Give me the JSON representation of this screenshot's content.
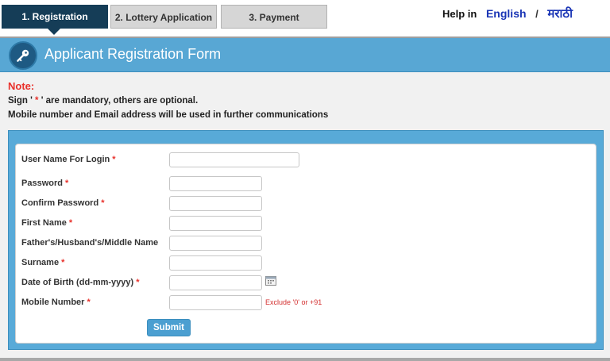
{
  "steps": [
    {
      "label": "1. Registration",
      "active": true
    },
    {
      "label": "2. Lottery Application",
      "active": false
    },
    {
      "label": "3. Payment",
      "active": false
    }
  ],
  "help": {
    "label": "Help in",
    "languages": [
      "English",
      "मराठी"
    ],
    "separator": "/"
  },
  "banner": {
    "title": "Applicant Registration Form",
    "icon": "key-icon"
  },
  "note": {
    "title": "Note:",
    "line1_prefix": "Sign '",
    "line1_star": " * ",
    "line1_suffix": "' are mandatory, others are optional.",
    "line2": "Mobile number and Email address will be used in further communications"
  },
  "form": {
    "fields": [
      {
        "label": "User Name For Login",
        "required": true,
        "value": "",
        "placeholder": ""
      },
      {
        "label": "Password",
        "required": true,
        "value": "",
        "placeholder": ""
      },
      {
        "label": "Confirm Password",
        "required": true,
        "value": "",
        "placeholder": ""
      },
      {
        "label": "First Name",
        "required": true,
        "value": "",
        "placeholder": ""
      },
      {
        "label": "Father's/Husband's/Middle Name",
        "required": false,
        "value": "",
        "placeholder": ""
      },
      {
        "label": "Surname",
        "required": true,
        "value": "",
        "placeholder": ""
      },
      {
        "label": "Date of Birth (dd-mm-yyyy)",
        "required": true,
        "value": "",
        "placeholder": ""
      },
      {
        "label": "Mobile Number",
        "required": true,
        "value": "",
        "placeholder": ""
      }
    ],
    "required_marker": "*",
    "mobile_hint": "Exclude '0' or +91",
    "calendar_icon": "calendar-icon",
    "submit_label": "Submit"
  },
  "colors": {
    "active_step": "#153d57",
    "banner": "#58a7d4",
    "required": "#e8302a",
    "link": "#1a35b5",
    "submit": "#4b9fd1"
  }
}
